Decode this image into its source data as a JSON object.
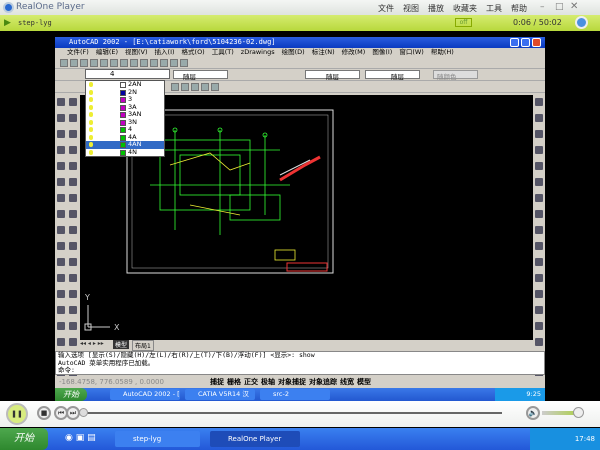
{
  "player": {
    "title": "RealOne Player",
    "menu": [
      "文件",
      "视图",
      "播放",
      "收藏夹",
      "工具",
      "帮助"
    ],
    "clip": "step-lyg",
    "indicator": "off",
    "time": "0:06 / 50:02",
    "progress_fraction": 0.002,
    "volume_fraction": 0.9
  },
  "acad": {
    "title": "AutoCAD 2002 - [E:\\catiawork\\ford\\5104236-02.dwg]",
    "menu": [
      "文件(F)",
      "编辑(E)",
      "视图(V)",
      "插入(I)",
      "格式(O)",
      "工具(T)",
      "zDrawings",
      "绘图(D)",
      "标注(N)",
      "修改(M)",
      "图像(I)",
      "窗口(W)",
      "帮助(H)"
    ],
    "layer_current": "4",
    "color_value": "随层",
    "linetype_value": "随层",
    "lineweight_value": "随层",
    "plotstyle_value": "随颜色",
    "layers": [
      "2AN",
      "2N",
      "3",
      "3A",
      "3AN",
      "3N",
      "4",
      "4A",
      "4AN",
      "4N"
    ],
    "selected_layer": "4AN",
    "layer_colors": [
      "#ffffff",
      "#0000a0",
      "#c000c0",
      "#c000c0",
      "#c000c0",
      "#c000c0",
      "#00c000",
      "#00c000",
      "#00c000",
      "#00c000"
    ],
    "tabs": [
      "模型",
      "布局1"
    ],
    "cmd_lines": [
      "输入选项 [显示(S)/隐藏(H)/左(L)/右(R)/上(T)/下(B)/浮动(F)] <显示>: show",
      "AutoCAD 菜单实用程序已加载。",
      "命令:"
    ],
    "coords": "-168.4758, 776.0589 , 0.0000",
    "status_toggles": [
      "捕捉",
      "栅格",
      "正交",
      "极轴",
      "对象捕捉",
      "对象追踪",
      "线宽",
      "模型"
    ],
    "axis_y": "Y",
    "axis_x": "X"
  },
  "inner_taskbar": {
    "start": "开始",
    "items": [
      "AutoCAD 2002 - [",
      "CATIA V5R14 汉化",
      "src-2"
    ],
    "clock": "9:25"
  },
  "taskbar": {
    "start": "开始",
    "items": [
      "step-lyg",
      "RealOne Player"
    ],
    "clock": "17:48"
  }
}
